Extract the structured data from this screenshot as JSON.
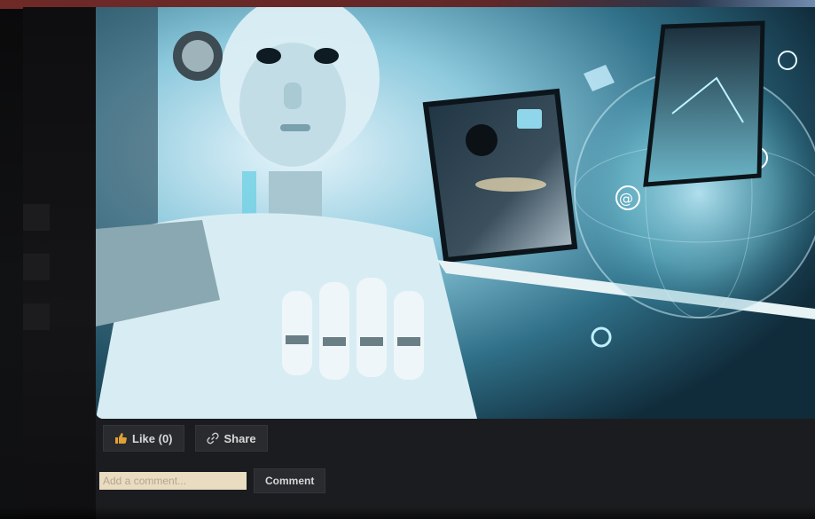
{
  "post": {
    "image_alt": "Robot with laptop and tablet, digital globe",
    "actions": {
      "like_label": "Like (0)",
      "share_label": "Share"
    },
    "comment": {
      "placeholder": "Add a comment...",
      "button_label": "Comment"
    }
  },
  "icons": {
    "like": "thumbs-up-icon",
    "share": "link-icon"
  },
  "colors": {
    "like_icon": "#e0a034",
    "share_icon": "#cfcfcf",
    "input_background": "#e9dcc1",
    "panel_background": "#1b1c1f"
  }
}
